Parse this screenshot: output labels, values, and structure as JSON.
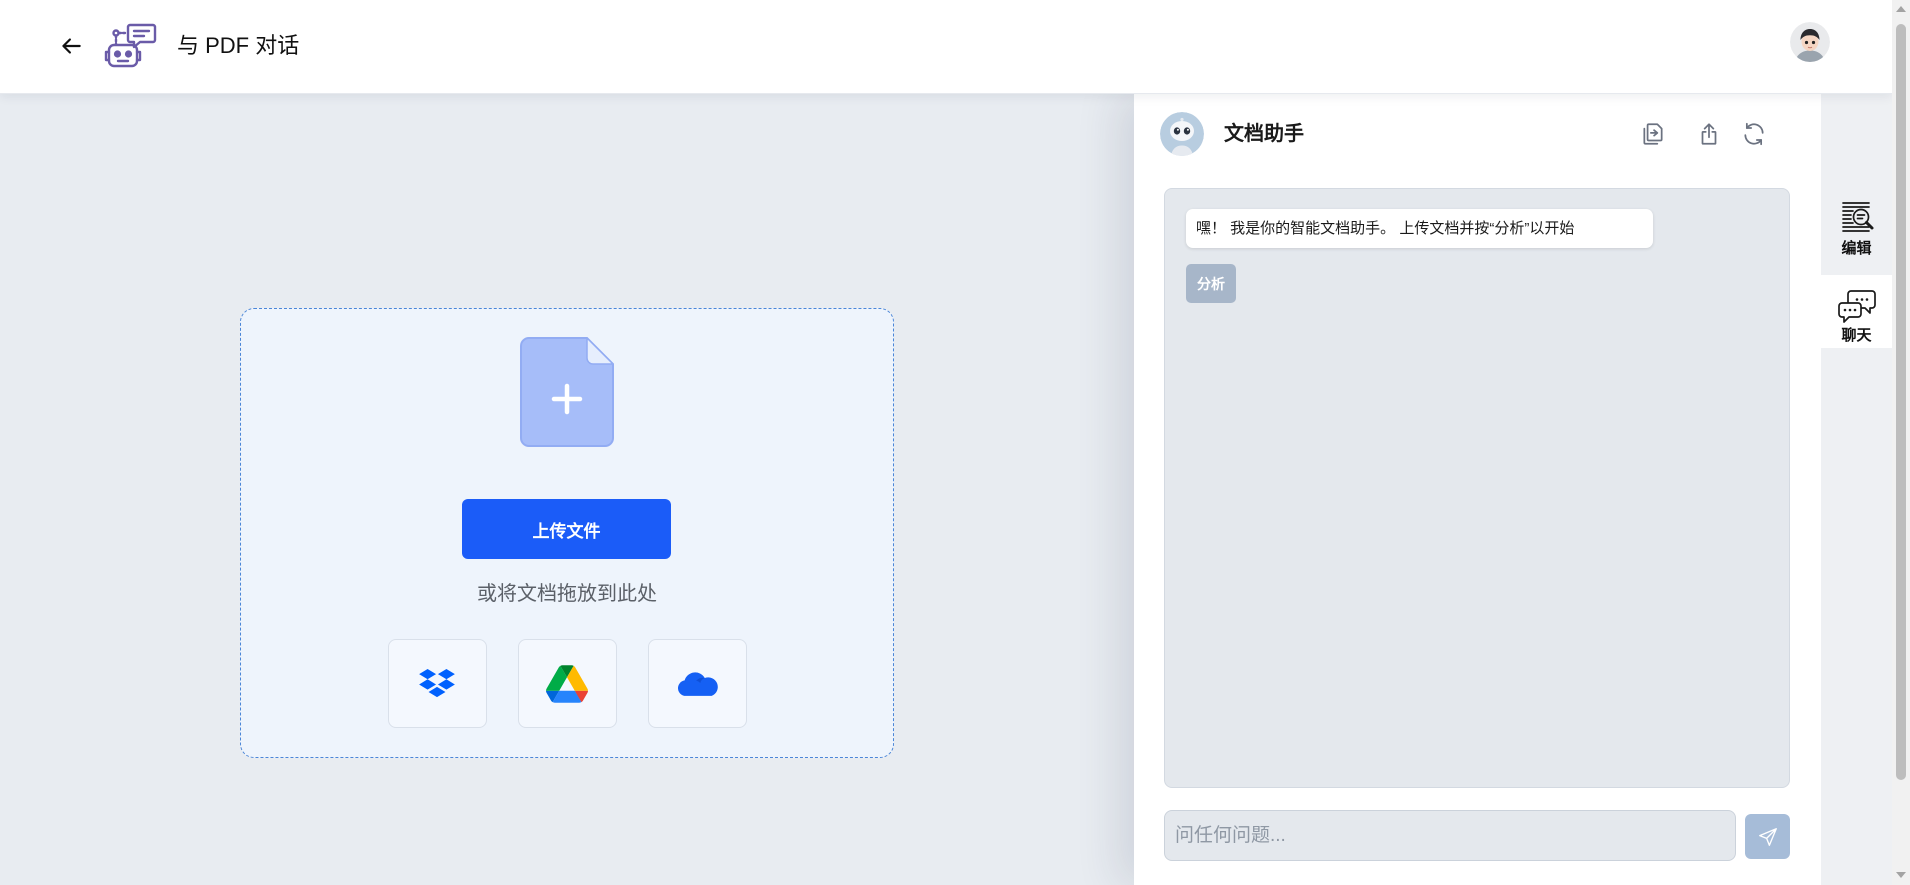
{
  "header": {
    "title": "与 PDF 对话",
    "back_icon": "arrow-left-icon",
    "logo_icon": "robot-chat-icon",
    "avatar_icon": "user-avatar"
  },
  "upload": {
    "file_icon": "file-plus-icon",
    "button_label": "上传文件",
    "drop_hint": "或将文档拖放到此处",
    "sources": [
      {
        "icon": "dropbox-icon"
      },
      {
        "icon": "google-drive-icon"
      },
      {
        "icon": "onedrive-icon"
      }
    ]
  },
  "chat": {
    "assistant_name": "文档助手",
    "assistant_avatar_icon": "robot-avatar",
    "toolbar_icons": [
      "copy-icon",
      "share-icon",
      "refresh-icon"
    ],
    "messages": [
      {
        "text": "嘿！ 我是你的智能文档助手。 上传文档并按“分析”以开始"
      }
    ],
    "analyze_button_label": "分析",
    "input_placeholder": "问任何问题...",
    "send_icon": "send-icon"
  },
  "sidebar": {
    "items": [
      {
        "label": "编辑",
        "icon": "document-search-icon",
        "active": false
      },
      {
        "label": "聊天",
        "icon": "chat-bubbles-icon",
        "active": true
      }
    ]
  },
  "colors": {
    "accent": "#1b5cf8",
    "page_background": "#e8ecf1",
    "dropzone_border": "#4b86d8",
    "dropzone_background": "#eef4fc",
    "file_icon": "#a6bdf9",
    "logo_purple": "#6a5ba8",
    "analyze_button": "#a7b6c9",
    "send_button": "#a6bcd8"
  }
}
